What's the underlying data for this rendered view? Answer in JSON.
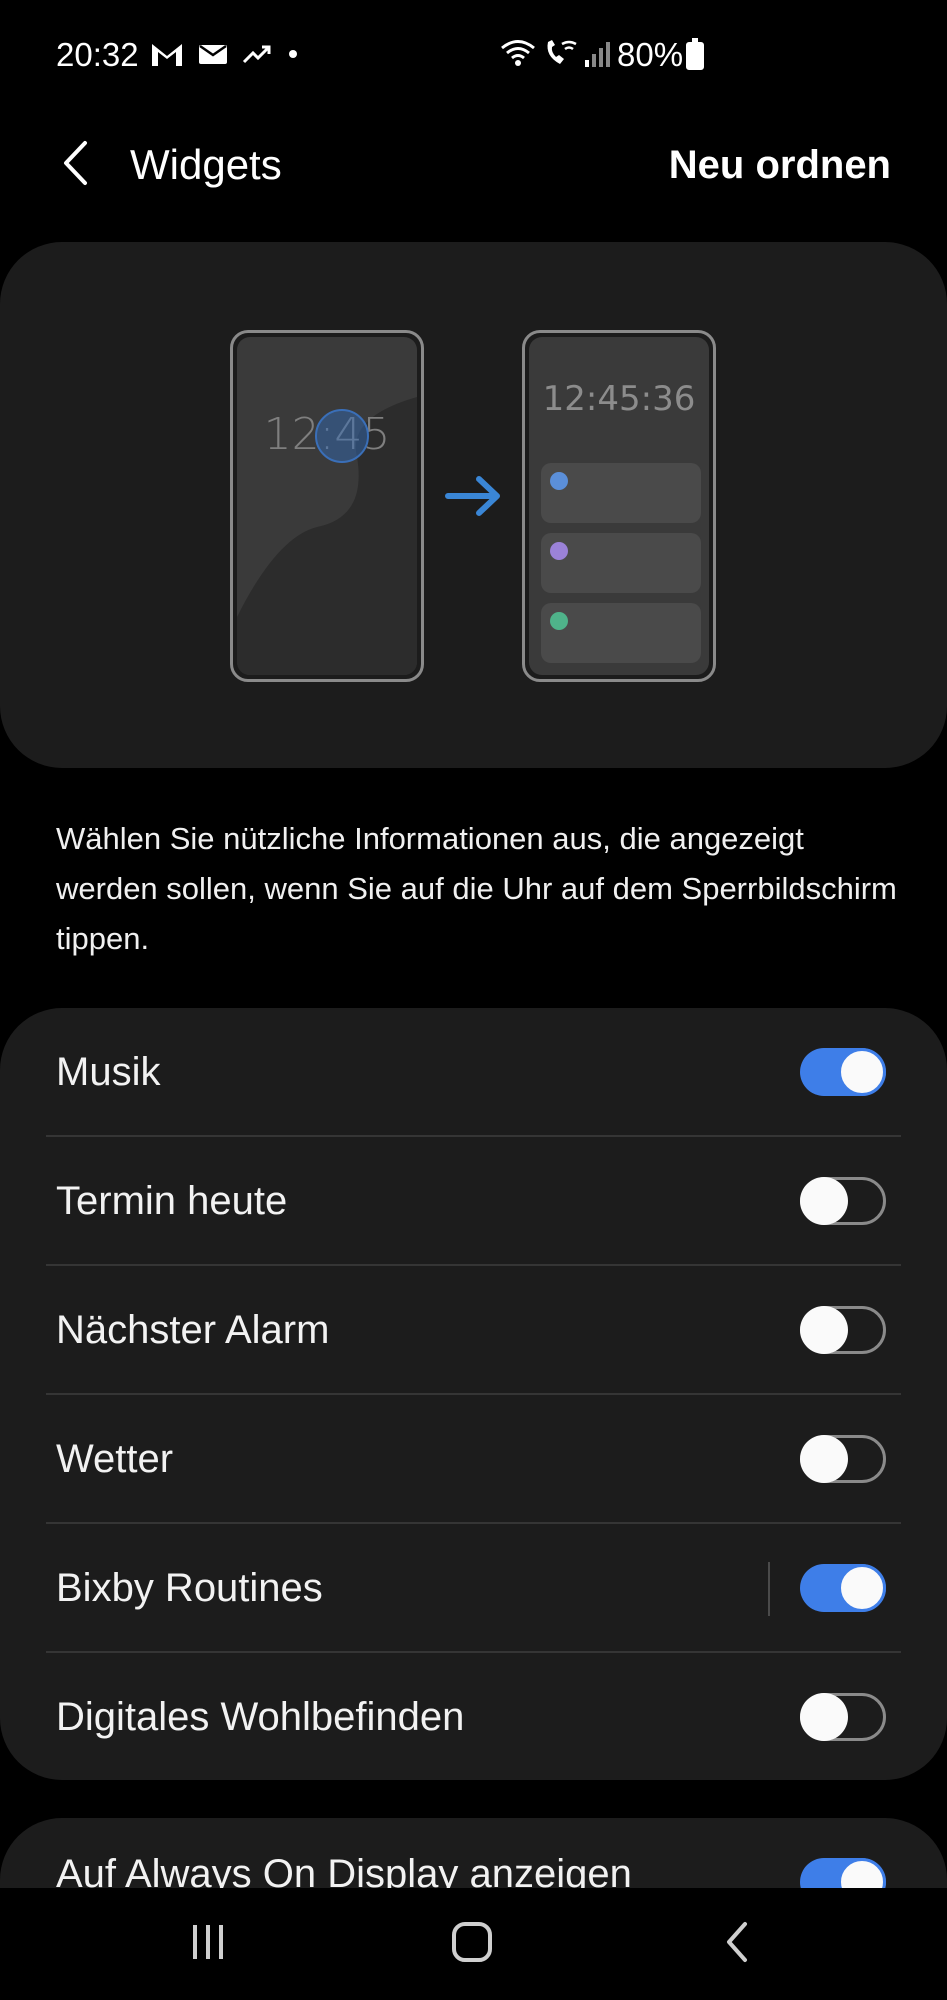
{
  "status_bar": {
    "time": "20:32",
    "battery_text": "80%",
    "left_icons": [
      "gmail-icon",
      "mail-icon",
      "trending-icon",
      "dot-icon"
    ],
    "right_icons": [
      "wifi-icon",
      "wifi-call-icon",
      "signal-icon",
      "battery-icon"
    ]
  },
  "header": {
    "title": "Widgets",
    "reorder_label": "Neu ordnen",
    "back_icon": "back-arrow-icon"
  },
  "illustration": {
    "left_clock": "12:45",
    "right_clock": "12:45:36",
    "widget_dot_colors": [
      "#5b8fd9",
      "#9b82d8",
      "#4fb38a"
    ],
    "arrow_color": "#3a86d6"
  },
  "description": "Wählen Sie nützliche Informationen aus, die angezeigt werden sollen, wenn Sie auf die Uhr auf dem Sperrbildschirm tippen.",
  "widgets": [
    {
      "label": "Musik",
      "enabled": true
    },
    {
      "label": "Termin heute",
      "enabled": false
    },
    {
      "label": "Nächster Alarm",
      "enabled": false
    },
    {
      "label": "Wetter",
      "enabled": false
    },
    {
      "label": "Bixby Routines",
      "enabled": true
    },
    {
      "label": "Digitales Wohlbefinden",
      "enabled": false
    }
  ],
  "aod": {
    "label": "Auf Always On Display anzeigen",
    "enabled": true
  },
  "navbar": {
    "icons": [
      "recents-icon",
      "home-icon",
      "back-icon"
    ]
  },
  "colors": {
    "accent": "#3e7ee8",
    "card_bg": "#1c1c1c",
    "page_bg": "#000000"
  }
}
